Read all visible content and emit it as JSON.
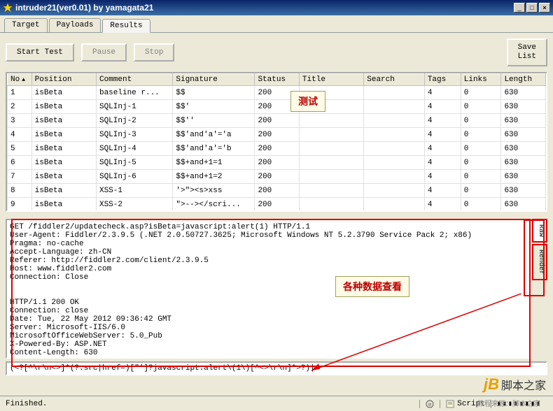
{
  "window": {
    "title": "intruder21(ver0.01) by yamagata21"
  },
  "tabs": [
    {
      "label": "Target"
    },
    {
      "label": "Payloads"
    },
    {
      "label": "Results"
    }
  ],
  "toolbar": {
    "start": "Start Test",
    "pause": "Pause",
    "stop": "Stop",
    "save": "Save\nList"
  },
  "table": {
    "headers": [
      "No",
      "Position",
      "Comment",
      "Signature",
      "Status",
      "Title",
      "Search",
      "Tags",
      "Links",
      "Length"
    ],
    "rows": [
      {
        "no": "1",
        "position": "isBeta",
        "comment": "baseline r...",
        "signature": "$$",
        "status": "200",
        "title": "",
        "search": "",
        "tags": "4",
        "links": "0",
        "length": "630"
      },
      {
        "no": "2",
        "position": "isBeta",
        "comment": "SQLInj-1",
        "signature": "$$'",
        "status": "200",
        "title": "",
        "search": "",
        "tags": "4",
        "links": "0",
        "length": "630"
      },
      {
        "no": "3",
        "position": "isBeta",
        "comment": "SQLInj-2",
        "signature": "$$''",
        "status": "200",
        "title": "",
        "search": "",
        "tags": "4",
        "links": "0",
        "length": "630"
      },
      {
        "no": "4",
        "position": "isBeta",
        "comment": "SQLInj-3",
        "signature": "$$'and'a'='a",
        "status": "200",
        "title": "",
        "search": "",
        "tags": "4",
        "links": "0",
        "length": "630"
      },
      {
        "no": "5",
        "position": "isBeta",
        "comment": "SQLInj-4",
        "signature": "$$'and'a'='b",
        "status": "200",
        "title": "",
        "search": "",
        "tags": "4",
        "links": "0",
        "length": "630"
      },
      {
        "no": "6",
        "position": "isBeta",
        "comment": "SQLInj-5",
        "signature": "$$+and+1=1",
        "status": "200",
        "title": "",
        "search": "",
        "tags": "4",
        "links": "0",
        "length": "630"
      },
      {
        "no": "7",
        "position": "isBeta",
        "comment": "SQLInj-6",
        "signature": "$$+and+1=2",
        "status": "200",
        "title": "",
        "search": "",
        "tags": "4",
        "links": "0",
        "length": "630"
      },
      {
        "no": "8",
        "position": "isBeta",
        "comment": "XSS-1",
        "signature": "'>\"><s>xss",
        "status": "200",
        "title": "",
        "search": "",
        "tags": "4",
        "links": "0",
        "length": "630"
      },
      {
        "no": "9",
        "position": "isBeta",
        "comment": "XSS-2",
        "signature": "\">--></scri...",
        "status": "200",
        "title": "",
        "search": "",
        "tags": "4",
        "links": "0",
        "length": "630"
      }
    ]
  },
  "detail": {
    "text": "GET /fiddler2/updatecheck.asp?isBeta=javascript:alert(1) HTTP/1.1\nUser-Agent: Fiddler/2.3.9.5 (.NET 2.0.50727.3625; Microsoft Windows NT 5.2.3790 Service Pack 2; x86)\nPragma: no-cache\nAccept-Language: zh-CN\nReferer: http://fiddler2.com/client/2.3.9.5\nHost: www.fiddler2.com\nConnection: Close\n\n\nHTTP/1.1 200 OK\nConnection: close\nDate: Tue, 22 May 2012 09:36:42 GMT\nServer: Microsoft-IIS/6.0\nMicrosoftOfficeWebServer: 5.0_Pub\nX-Powered-By: ASP.NET\nContent-Length: 630"
  },
  "side_tabs": {
    "raw": "Raw",
    "render": "Render"
  },
  "regex": {
    "value": "(<?[^\\r\\n<>]*(?:src|href=)[\"']?javascript:alert\\(1\\)[^<>\\r\\n]*>?)|"
  },
  "status": {
    "text": "Finished.",
    "script": "Script"
  },
  "callouts": {
    "c1": "测试",
    "c2": "各种数据查看"
  },
  "watermark": {
    "jb": "jB",
    "text": "脚本之家",
    "sub": "教程来源：脚本之家"
  }
}
